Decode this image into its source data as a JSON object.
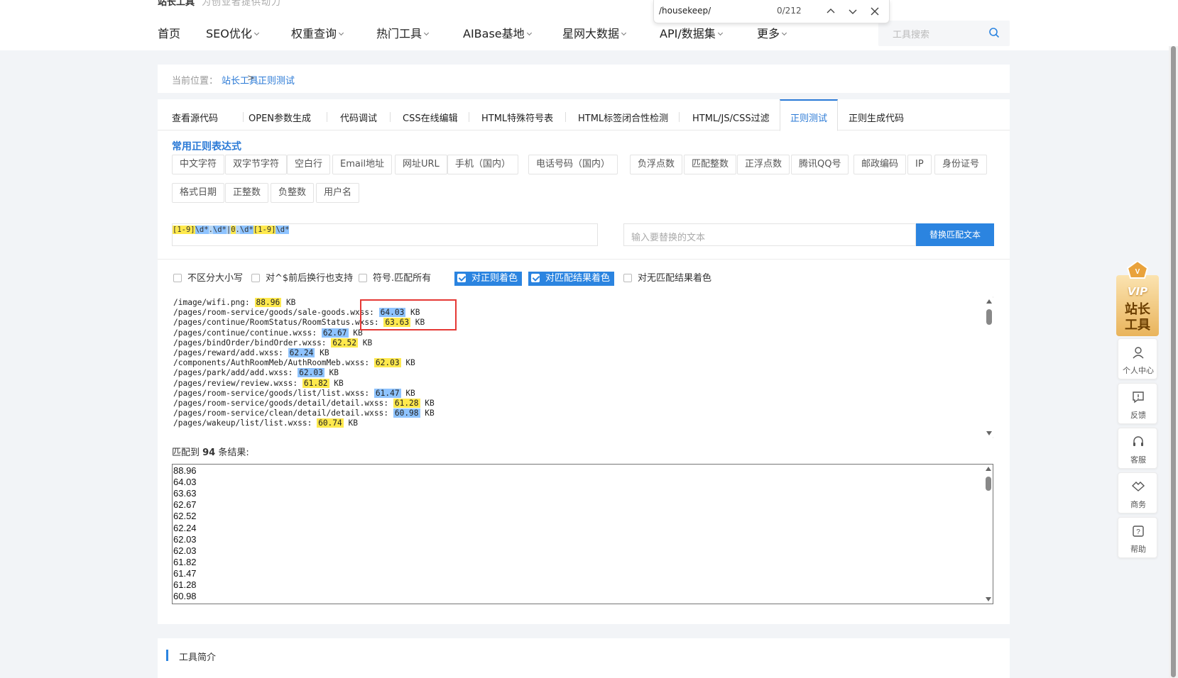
{
  "header": {
    "logo_text": "站长工具",
    "slogan": "为创业者提供动力",
    "nav": [
      {
        "label": "首页",
        "dropdown": false
      },
      {
        "label": "SEO优化",
        "dropdown": true
      },
      {
        "label": "权重查询",
        "dropdown": true
      },
      {
        "label": "热门工具",
        "dropdown": true
      },
      {
        "label": "AIBase基地",
        "dropdown": true
      },
      {
        "label": "星网大数据",
        "dropdown": true
      },
      {
        "label": "API/数据集",
        "dropdown": true
      },
      {
        "label": "更多",
        "dropdown": true
      }
    ],
    "search_placeholder": "工具搜索"
  },
  "findbar": {
    "query": "/housekeep/",
    "count": "0/212"
  },
  "breadcrumb": {
    "label": "当前位置：",
    "items": [
      "站长工具",
      "正则测试"
    ],
    "separator": ">"
  },
  "tabs": [
    {
      "label": "查看源代码",
      "active": false
    },
    {
      "label": "OPEN参数生成",
      "active": false
    },
    {
      "label": "代码调试",
      "active": false
    },
    {
      "label": "CSS在线编辑",
      "active": false
    },
    {
      "label": "HTML特殊符号表",
      "active": false
    },
    {
      "label": "HTML标签闭合性检测",
      "active": false
    },
    {
      "label": "HTML/JS/CSS过滤",
      "active": false
    },
    {
      "label": "正则测试",
      "active": true
    },
    {
      "label": "正则生成代码",
      "active": false
    }
  ],
  "common_regex": {
    "title": "常用正则表达式",
    "row1": [
      "中文字符",
      "双字节字符",
      "空白行",
      "Email地址",
      "网址URL",
      "手机（国内）",
      "电话号码（国内）",
      "负浮点数",
      "匹配整数",
      "正浮点数",
      "腾讯QQ号",
      "邮政编码",
      "IP",
      "身份证号"
    ],
    "row2": [
      "格式日期",
      "正整数",
      "负整数",
      "用户名"
    ]
  },
  "regex": {
    "tokens": [
      {
        "text": "[1-9]",
        "hl": "y"
      },
      {
        "text": "\\d*",
        "hl": "b"
      },
      {
        "text": ".",
        "hl": "g"
      },
      {
        "text": "\\d*",
        "hl": "b"
      },
      {
        "text": "|",
        "hl": "g"
      },
      {
        "text": "0",
        "hl": "y"
      },
      {
        "text": ".",
        "hl": "g"
      },
      {
        "text": "\\d*",
        "hl": "b"
      },
      {
        "text": "[1-9]",
        "hl": "y"
      },
      {
        "text": "\\d*",
        "hl": "b"
      }
    ],
    "replace_placeholder": "输入要替换的文本",
    "replace_button": "替换匹配文本"
  },
  "options": [
    {
      "label": "不区分大小写",
      "checked": false
    },
    {
      "label": "对^$前后换行也支持",
      "checked": false
    },
    {
      "label": "符号.匹配所有",
      "checked": false
    },
    {
      "label": "对正则着色",
      "checked": true
    },
    {
      "label": "对匹配结果着色",
      "checked": true
    },
    {
      "label": "对无匹配结果着色",
      "checked": false
    }
  ],
  "code_lines": [
    {
      "pre": "/image/wifi.png: ",
      "num": "88.96",
      "hl": "y",
      "post": " KB"
    },
    {
      "pre": "/pages/room-service/goods/sale-goods.wxss: ",
      "num": "64.03",
      "hl": "b",
      "post": " KB"
    },
    {
      "pre": "/pages/continue/RoomStatus/RoomStatus.wxss: ",
      "num": "63.63",
      "hl": "y",
      "post": " KB"
    },
    {
      "pre": "/pages/continue/continue.wxss: ",
      "num": "62.67",
      "hl": "b",
      "post": " KB"
    },
    {
      "pre": "/pages/bindOrder/bindOrder.wxss: ",
      "num": "62.52",
      "hl": "y",
      "post": " KB"
    },
    {
      "pre": "/pages/reward/add.wxss: ",
      "num": "62.24",
      "hl": "b",
      "post": " KB"
    },
    {
      "pre": "/components/AuthRoomMeb/AuthRoomMeb.wxss: ",
      "num": "62.03",
      "hl": "y",
      "post": " KB"
    },
    {
      "pre": "/pages/park/add/add.wxss: ",
      "num": "62.03",
      "hl": "b",
      "post": " KB"
    },
    {
      "pre": "/pages/review/review.wxss: ",
      "num": "61.82",
      "hl": "y",
      "post": " KB"
    },
    {
      "pre": "/pages/room-service/goods/list/list.wxss: ",
      "num": "61.47",
      "hl": "b",
      "post": " KB"
    },
    {
      "pre": "/pages/room-service/goods/detail/detail.wxss: ",
      "num": "61.28",
      "hl": "y",
      "post": " KB"
    },
    {
      "pre": "/pages/room-service/clean/detail/detail.wxss: ",
      "num": "60.98",
      "hl": "b",
      "post": " KB"
    },
    {
      "pre": "/pages/wakeup/list/list.wxss: ",
      "num": "60.74",
      "hl": "y",
      "post": " KB"
    }
  ],
  "result": {
    "prefix": "匹配到 ",
    "count": "94",
    "suffix": " 条结果:",
    "values": [
      "88.96",
      "64.03",
      "63.63",
      "62.67",
      "62.52",
      "62.24",
      "62.03",
      "62.03",
      "61.82",
      "61.47",
      "61.28",
      "60.98"
    ]
  },
  "intro_title": "工具简介",
  "vip_badge": {
    "line1": "VIP",
    "line2": "站长",
    "line3": "工具"
  },
  "side_widgets": [
    {
      "label": "个人中心",
      "icon": "user-icon"
    },
    {
      "label": "反馈",
      "icon": "feedback-icon"
    },
    {
      "label": "客服",
      "icon": "headset-icon"
    },
    {
      "label": "商务",
      "icon": "handshake-icon"
    },
    {
      "label": "帮助",
      "icon": "help-icon"
    }
  ],
  "colors": {
    "accent": "#2b84e0",
    "highlight_yellow": "#ffe94d",
    "highlight_blue": "#8ec3ff",
    "red_box": "#e53935"
  }
}
